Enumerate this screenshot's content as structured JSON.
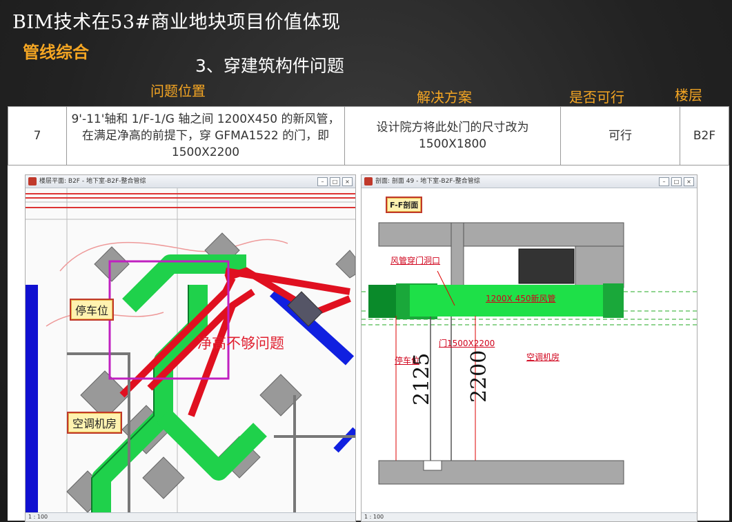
{
  "header": {
    "title": "BIM技术在53#商业地块项目价值体现",
    "subtitle": "管线综合",
    "section": "3、穿建筑构件问题"
  },
  "table": {
    "columns": [
      "问题位置",
      "解决方案",
      "是否可行",
      "楼层"
    ],
    "row": {
      "index": "7",
      "location": "9'-11'轴和 1/F-1/G 轴之间 1200X450 的新风管，在满足净高的前提下，穿 GFMA1522 的门，即 1500X2200",
      "solution": "设计院方将此处门的尺寸改为 1500X1800",
      "feasible": "可行",
      "floor": "B2F"
    }
  },
  "left_window": {
    "title": "楼层平面: B2F - 地下室-B2F-整合管综",
    "tags": {
      "parking": "停车位",
      "ac_room": "空调机房"
    },
    "problem_label": "净高不够问题",
    "status": "1 : 100",
    "icon": "revit-icon"
  },
  "right_window": {
    "title": "剖面: 剖面 49 - 地下室-B2F-整合管综",
    "section_tag": "F-F剖面",
    "labels": {
      "duct_opening": "风管穿门洞口",
      "duct": "1200X 450新风管",
      "door": "门1500X2200",
      "parking": "停车位",
      "ac_room": "空调机房"
    },
    "dims": [
      "2125",
      "2200"
    ],
    "status": "1 : 100",
    "icon": "revit-icon"
  },
  "colors": {
    "accent": "#f5a623",
    "duct_green": "#1fd14b",
    "pipe_red": "#e01020",
    "pipe_blue": "#1020e0"
  }
}
